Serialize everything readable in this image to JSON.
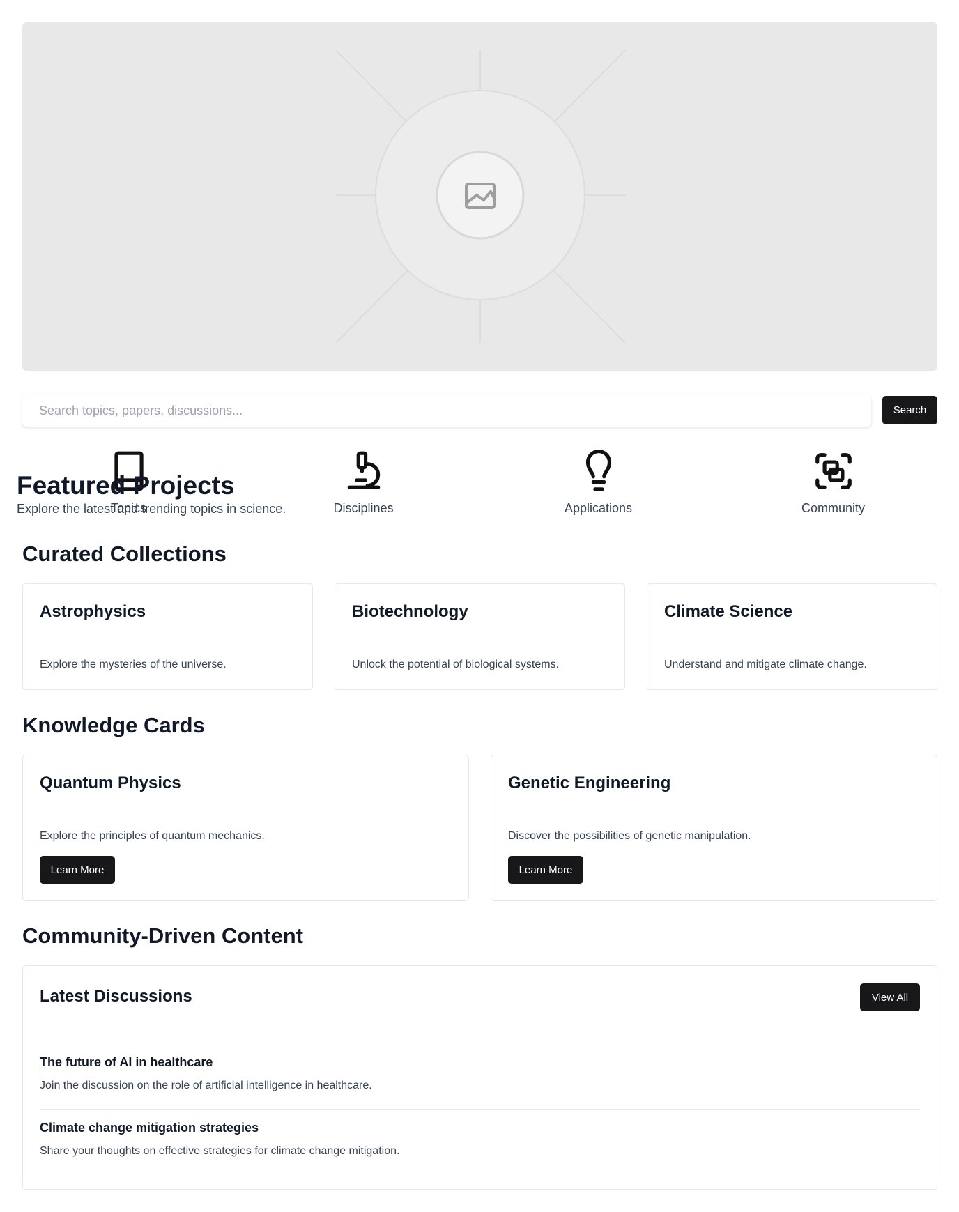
{
  "hero": {
    "icon": "image-placeholder-icon"
  },
  "search": {
    "placeholder": "Search topics, papers, discussions...",
    "value": "",
    "button": "Search"
  },
  "features": [
    {
      "label": "Topics",
      "icon": "book-icon"
    },
    {
      "label": "Disciplines",
      "icon": "microscope-icon"
    },
    {
      "label": "Applications",
      "icon": "lightbulb-icon"
    },
    {
      "label": "Community",
      "icon": "group-icon"
    }
  ],
  "featured": {
    "title": "Featured Projects",
    "subtitle": "Explore the latest and trending topics in science."
  },
  "curated": {
    "title": "Curated Collections",
    "cards": [
      {
        "title": "Astrophysics",
        "desc": "Explore the mysteries of the universe."
      },
      {
        "title": "Biotechnology",
        "desc": "Unlock the potential of biological systems."
      },
      {
        "title": "Climate Science",
        "desc": "Understand and mitigate climate change."
      }
    ]
  },
  "knowledge": {
    "title": "Knowledge Cards",
    "cards": [
      {
        "title": "Quantum Physics",
        "desc": "Explore the principles of quantum mechanics.",
        "button": "Learn More"
      },
      {
        "title": "Genetic Engineering",
        "desc": "Discover the possibilities of genetic manipulation.",
        "button": "Learn More"
      }
    ]
  },
  "community": {
    "title": "Community-Driven Content",
    "box_title": "Latest Discussions",
    "view_all": "View All",
    "items": [
      {
        "title": "The future of AI in healthcare",
        "desc": "Join the discussion on the role of artificial intelligence in healthcare."
      },
      {
        "title": "Climate change mitigation strategies",
        "desc": "Share your thoughts on effective strategies for climate change mitigation."
      }
    ]
  }
}
